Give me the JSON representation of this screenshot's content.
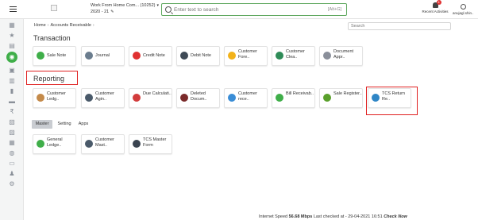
{
  "header": {
    "company_line1": "Work From Home Com... (10252)",
    "company_line2": "2020 - 21",
    "search_placeholder": "Enter text to search",
    "search_shortcut": "[Alt+G]",
    "recent_label": "Recent Activities",
    "recent_count": "4",
    "user_name": "anujagl.shin.."
  },
  "breadcrumb": {
    "home": "Home",
    "current": "Accounts Receivable"
  },
  "page_search_placeholder": "Search",
  "sections": {
    "transaction": {
      "title": "Transaction",
      "cards": [
        {
          "label": "Sale Note",
          "icon": "sale-note-icon",
          "color": "#3fae49"
        },
        {
          "label": "Journal",
          "icon": "journal-icon",
          "color": "#6b7d8e"
        },
        {
          "label": "Credit Note",
          "icon": "credit-note-icon",
          "color": "#e03131"
        },
        {
          "label": "Debit Note",
          "icon": "debit-note-icon",
          "color": "#3f4a56"
        },
        {
          "label": "Customer Fore..",
          "icon": "customer-forecast-icon",
          "color": "#f2b21a"
        },
        {
          "label": "Customer Clea..",
          "icon": "customer-clearance-icon",
          "color": "#2e8b57"
        },
        {
          "label": "Document Appr..",
          "icon": "document-approval-icon",
          "color": "#8a8f9a"
        }
      ]
    },
    "reporting": {
      "title": "Reporting",
      "cards": [
        {
          "label": "Customer Ledg..",
          "icon": "customer-ledger-icon",
          "color": "#c48a4a"
        },
        {
          "label": "Customer Agin..",
          "icon": "customer-ageing-icon",
          "color": "#4a5a6a"
        },
        {
          "label": "Due Calculati..",
          "icon": "due-calculation-icon",
          "color": "#d23c3c"
        },
        {
          "label": "Deleted Docum..",
          "icon": "deleted-document-icon",
          "color": "#7a2a2a"
        },
        {
          "label": "Customer rece..",
          "icon": "customer-receipt-icon",
          "color": "#3a8dd6"
        },
        {
          "label": "Bill Receivab..",
          "icon": "bill-receivable-icon",
          "color": "#3fae49"
        },
        {
          "label": "Sale Register..",
          "icon": "sale-register-icon",
          "color": "#5aa02c"
        },
        {
          "label": "TCS Return Re..",
          "icon": "tcs-return-icon",
          "color": "#2f86c6"
        }
      ]
    },
    "master": {
      "tabs": [
        "Master",
        "Setting",
        "Apps"
      ],
      "cards": [
        {
          "label": "General Ledge..",
          "icon": "general-ledger-icon",
          "color": "#3fae49"
        },
        {
          "label": "Customer Mast..",
          "icon": "customer-master-icon",
          "color": "#4a5a6a"
        },
        {
          "label": "TCS Master Form",
          "icon": "tcs-master-icon",
          "color": "#3a4450"
        }
      ]
    }
  },
  "status": {
    "prefix": "Internet Speed",
    "speed": "56.68 Mbps",
    "checked": "Last checked at - 29-04-2021 16:51",
    "action": "Check Now"
  }
}
